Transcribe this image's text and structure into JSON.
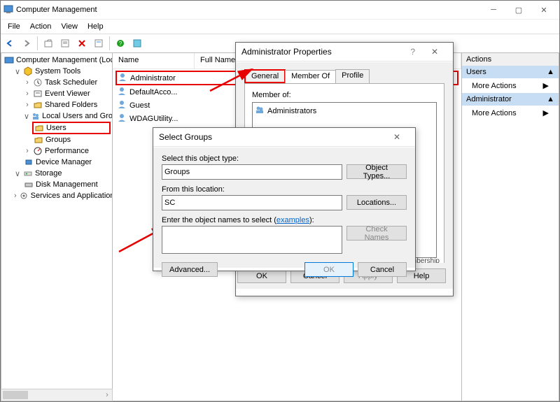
{
  "window_title": "Computer Management",
  "menus": {
    "file": "File",
    "action": "Action",
    "view": "View",
    "help": "Help"
  },
  "tree": {
    "root": "Computer Management (Local",
    "systools": "System Tools",
    "tasksched": "Task Scheduler",
    "eventviewer": "Event Viewer",
    "sharedfolders": "Shared Folders",
    "lug": "Local Users and Groups",
    "users": "Users",
    "groups": "Groups",
    "perf": "Performance",
    "devmgr": "Device Manager",
    "storage": "Storage",
    "diskmgmt": "Disk Management",
    "svcapp": "Services and Applications"
  },
  "list": {
    "col_name": "Name",
    "col_fullname": "Full Name",
    "rows": [
      "Administrator",
      "DefaultAcco...",
      "Guest",
      "WDAGUtility..."
    ]
  },
  "actions_panel": {
    "title": "Actions",
    "users": "Users",
    "admin": "Administrator",
    "more": "More Actions"
  },
  "prop_dialog": {
    "title": "Administrator Properties",
    "tabs": {
      "general": "General",
      "memberof": "Member Of",
      "profile": "Profile"
    },
    "memberof_label": "Member of:",
    "group": "Administrators",
    "note": "mbership\ntime the",
    "ok": "OK",
    "cancel": "Cancel",
    "apply": "Apply",
    "help": "Help"
  },
  "selgroups": {
    "title": "Select Groups",
    "obj_type_label": "Select this object type:",
    "obj_type_value": "Groups",
    "obj_types_btn": "Object Types...",
    "loc_label": "From this location:",
    "loc_value": "SC",
    "loc_btn": "Locations...",
    "names_label": "Enter the object names to select (",
    "examples": "examples",
    "names_label2": "):",
    "check_btn": "Check Names",
    "advanced": "Advanced...",
    "ok": "OK",
    "cancel": "Cancel"
  }
}
